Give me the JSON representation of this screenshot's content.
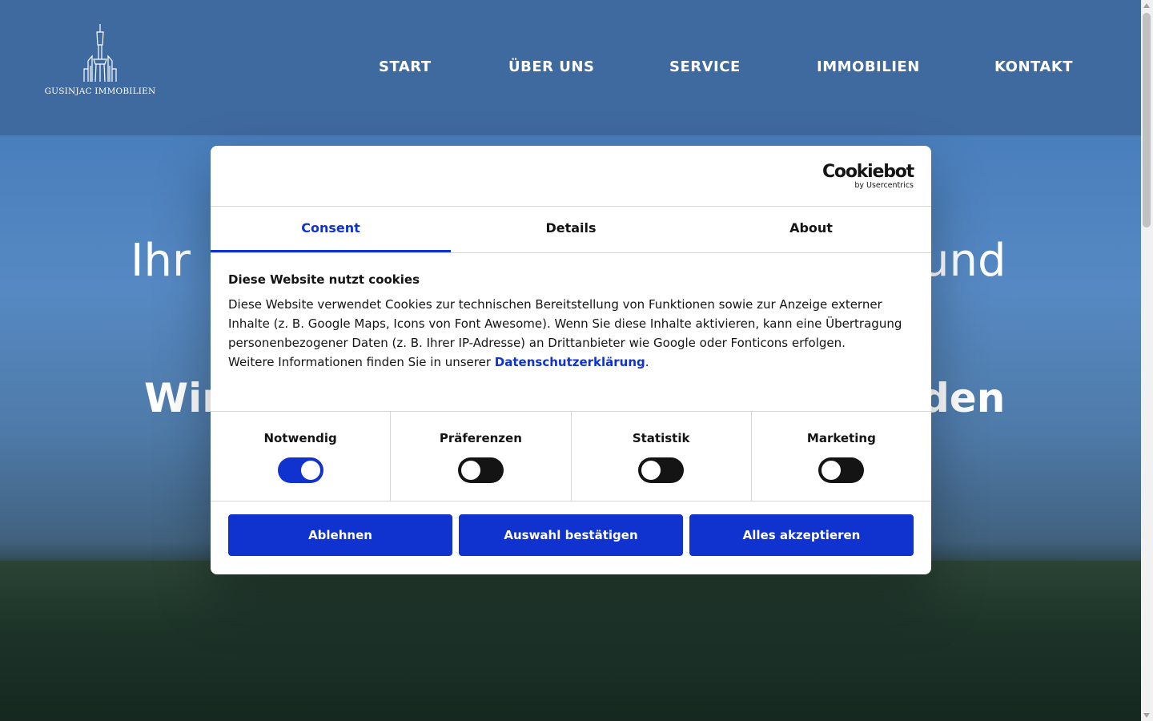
{
  "site": {
    "logo_text": "GUSINJAC IMMOBILIEN",
    "nav": [
      "START",
      "ÜBER UNS",
      "SERVICE",
      "IMMOBILIEN",
      "KONTAKT"
    ],
    "hero_line1_left": "Ihr",
    "hero_line1_right": "und",
    "hero_line2_left": "Wir",
    "hero_line2_right": "den"
  },
  "cookie_dialog": {
    "brand": "Cookiebot",
    "brand_sub": "by Usercentrics",
    "tabs": [
      "Consent",
      "Details",
      "About"
    ],
    "active_tab": "Consent",
    "heading": "Diese Website nutzt cookies",
    "paragraph": "Diese Website verwendet Cookies zur technischen Bereitstellung von Funktionen sowie zur Anzeige externer Inhalte (z. B. Google Maps, Icons von Font Awesome). Wenn Sie diese Inhalte aktivieren, kann eine Übertragung personenbezogener Daten (z. B. Ihrer IP-Adresse) an Drittanbieter wie Google oder Fonticons erfolgen.",
    "more_info_prefix": "Weitere Informationen finden Sie in unserer ",
    "more_info_link": "Datenschutzerklärung",
    "more_info_suffix": ".",
    "toggles": [
      {
        "label": "Notwendig",
        "checked": true
      },
      {
        "label": "Präferenzen",
        "checked": false
      },
      {
        "label": "Statistik",
        "checked": false
      },
      {
        "label": "Marketing",
        "checked": false
      }
    ],
    "buttons": {
      "decline": "Ablehnen",
      "confirm_selection": "Auswahl bestätigen",
      "accept_all": "Alles akzeptieren"
    },
    "accent_color": "#1032cf"
  }
}
